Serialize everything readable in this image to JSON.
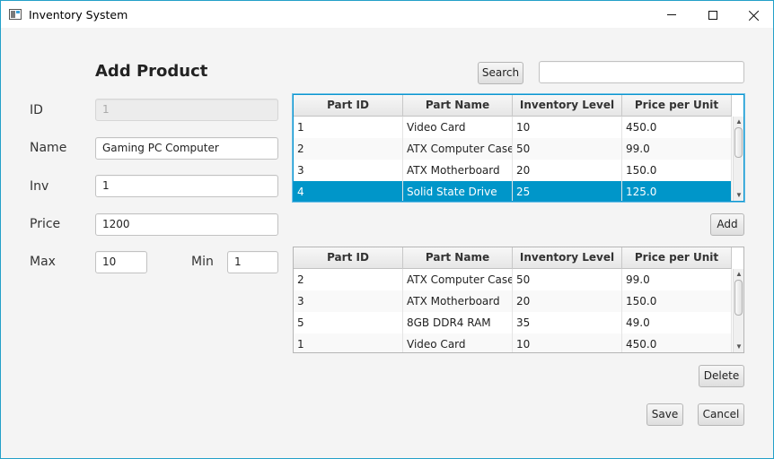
{
  "window": {
    "title": "Inventory System",
    "controls": {
      "minimize": "minimize-icon",
      "maximize": "maximize-icon",
      "close": "close-icon"
    }
  },
  "form": {
    "heading": "Add Product",
    "id_label": "ID",
    "id_value": "1",
    "name_label": "Name",
    "name_value": "Gaming PC Computer",
    "inv_label": "Inv",
    "inv_value": "1",
    "price_label": "Price",
    "price_value": "1200",
    "max_label": "Max",
    "max_value": "10",
    "min_label": "Min",
    "min_value": "1"
  },
  "search": {
    "button_label": "Search",
    "value": ""
  },
  "parts_table": {
    "columns": [
      "Part ID",
      "Part Name",
      "Inventory Level",
      "Price per Unit"
    ],
    "rows": [
      [
        "1",
        "Video Card",
        "10",
        "450.0"
      ],
      [
        "2",
        "ATX Computer Case",
        "50",
        "99.0"
      ],
      [
        "3",
        "ATX Motherboard",
        "20",
        "150.0"
      ],
      [
        "4",
        "Solid State Drive",
        "25",
        "125.0"
      ]
    ],
    "selected_row": 3
  },
  "associated_table": {
    "columns": [
      "Part ID",
      "Part Name",
      "Inventory Level",
      "Price per Unit"
    ],
    "rows": [
      [
        "2",
        "ATX Computer Case",
        "50",
        "99.0"
      ],
      [
        "3",
        "ATX Motherboard",
        "20",
        "150.0"
      ],
      [
        "5",
        "8GB DDR4 RAM",
        "35",
        "49.0"
      ],
      [
        "1",
        "Video Card",
        "10",
        "450.0"
      ]
    ]
  },
  "buttons": {
    "add": "Add",
    "delete": "Delete",
    "save": "Save",
    "cancel": "Cancel"
  },
  "colors": {
    "selection": "#0096c9",
    "window_border": "#23a0c8"
  }
}
